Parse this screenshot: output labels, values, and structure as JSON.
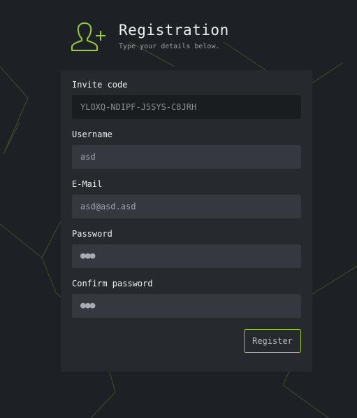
{
  "header": {
    "title": "Registration",
    "subtitle": "Type your details below.",
    "icon": "user-add-icon"
  },
  "form": {
    "invite": {
      "label": "Invite code",
      "value": "YLOXQ-NDIPF-J5SYS-C8JRH"
    },
    "username": {
      "label": "Username",
      "value": "asd"
    },
    "email": {
      "label": "E-Mail",
      "value": "asd@asd.asd"
    },
    "password": {
      "label": "Password",
      "value": "●●●"
    },
    "confirm": {
      "label": "Confirm password",
      "value": "●●●"
    },
    "submit_label": "Register"
  },
  "colors": {
    "accent": "#9acd32",
    "background": "#1d2024",
    "card": "#26292e",
    "input": "#35393f"
  }
}
